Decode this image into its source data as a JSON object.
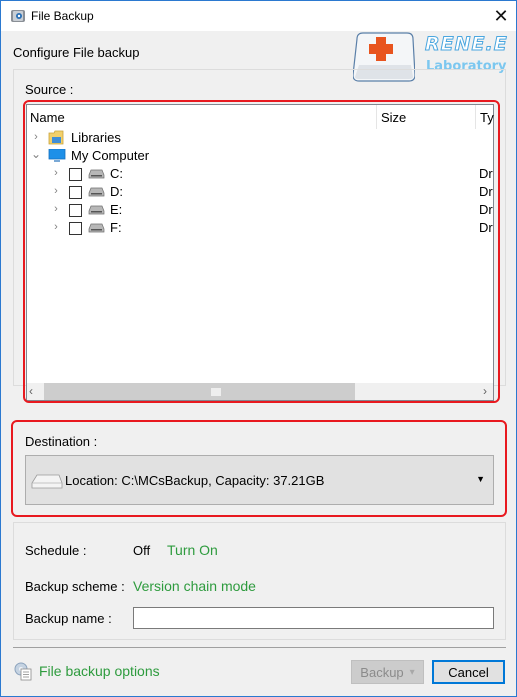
{
  "window": {
    "title": "File Backup",
    "close_glyph": "✕"
  },
  "header": {
    "configure_label": "Configure File backup",
    "logo": {
      "line1": "RENE.E",
      "line2": "Laboratory",
      "accent": "#e8541e"
    }
  },
  "source": {
    "label": "Source :",
    "columns": [
      "Name",
      "Size",
      "Ty"
    ],
    "tree": [
      {
        "label": "Libraries",
        "icon": "library-folder-icon",
        "expander": "›",
        "checkbox": false,
        "type": ""
      },
      {
        "label": "My Computer",
        "icon": "computer-icon",
        "expander": "⌄",
        "checkbox": false,
        "type": ""
      },
      {
        "label": "C:",
        "icon": "drive-icon",
        "expander": "›",
        "checkbox": true,
        "checked": false,
        "type": "Dr"
      },
      {
        "label": "D:",
        "icon": "drive-icon",
        "expander": "›",
        "checkbox": true,
        "checked": false,
        "type": "Dr"
      },
      {
        "label": "E:",
        "icon": "drive-icon",
        "expander": "›",
        "checkbox": true,
        "checked": false,
        "type": "Dr"
      },
      {
        "label": "F:",
        "icon": "drive-icon",
        "expander": "›",
        "checkbox": true,
        "checked": false,
        "type": "Dr"
      }
    ],
    "scroll_left": "‹",
    "scroll_right": "›"
  },
  "destination": {
    "label": "Destination :",
    "value": "Location: C:\\MCsBackup, Capacity: 37.21GB",
    "arrow": "▼"
  },
  "options": {
    "schedule_label": "Schedule :",
    "schedule_value": "Off",
    "schedule_link": "Turn On",
    "scheme_label": "Backup scheme :",
    "scheme_value": "Version chain mode",
    "name_label": "Backup name :",
    "name_value": ""
  },
  "footer": {
    "options_link": "File backup options",
    "backup_label": "Backup",
    "backup_arrow": "▾",
    "cancel_label": "Cancel"
  },
  "colors": {
    "highlight_outline": "#e8191f",
    "link_green": "#2e9b3e",
    "focus_blue": "#0078d7"
  }
}
